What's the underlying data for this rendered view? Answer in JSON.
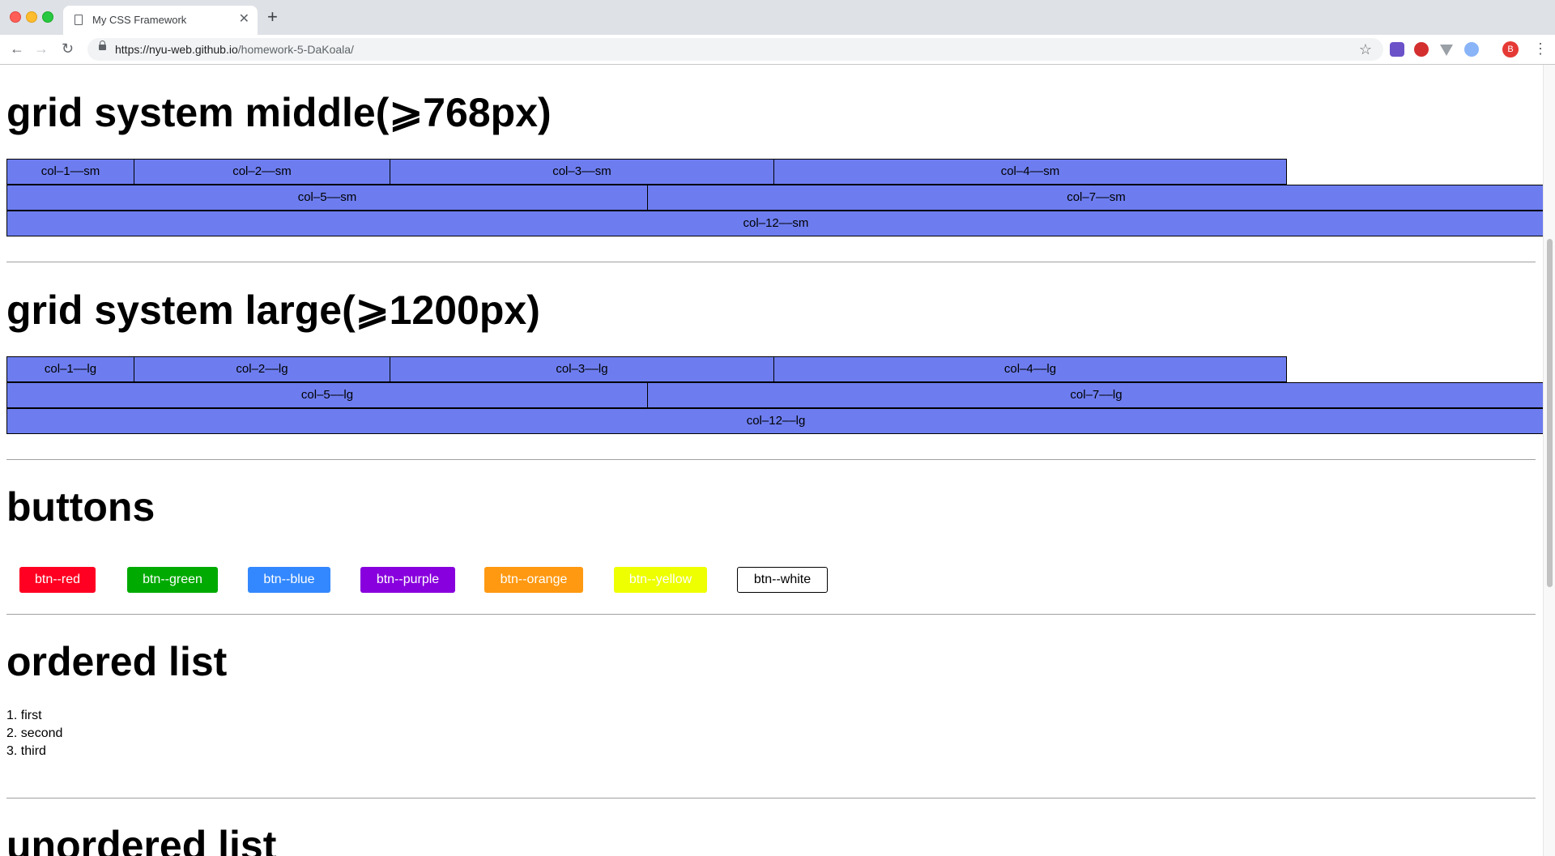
{
  "browser": {
    "tab_title": "My CSS Framework",
    "url_host": "https://nyu-web.github.io",
    "url_path": "/homework-5-DaKoala/",
    "profile_initial": "B"
  },
  "sections": {
    "middle": {
      "title": "grid system middle(⩾768px)",
      "cols": {
        "c1": "col–1––sm",
        "c2": "col–2––sm",
        "c3": "col–3––sm",
        "c4": "col–4––sm",
        "c5": "col–5––sm",
        "c7": "col–7––sm",
        "c12": "col–12––sm"
      }
    },
    "large": {
      "title": "grid system large(⩾1200px)",
      "cols": {
        "c1": "col–1––lg",
        "c2": "col–2––lg",
        "c3": "col–3––lg",
        "c4": "col–4––lg",
        "c5": "col–5––lg",
        "c7": "col–7––lg",
        "c12": "col–12––lg"
      }
    },
    "buttons": {
      "title": "buttons",
      "items": {
        "red": "btn--red",
        "green": "btn--green",
        "blue": "btn--blue",
        "purple": "btn--purple",
        "orange": "btn--orange",
        "yellow": "btn--yellow",
        "white": "btn--white"
      }
    },
    "ordered_list": {
      "title": "ordered list",
      "items": [
        "1. first",
        "2. second",
        "3. third"
      ]
    },
    "unordered_list": {
      "title": "unordered list"
    }
  },
  "colors": {
    "grid_cell": "#6d7def",
    "btn_red": "#ff0022",
    "btn_green": "#00aa00",
    "btn_blue": "#3388ff",
    "btn_purple": "#8800dd",
    "btn_orange": "#ff9911",
    "btn_yellow": "#eeff00"
  }
}
